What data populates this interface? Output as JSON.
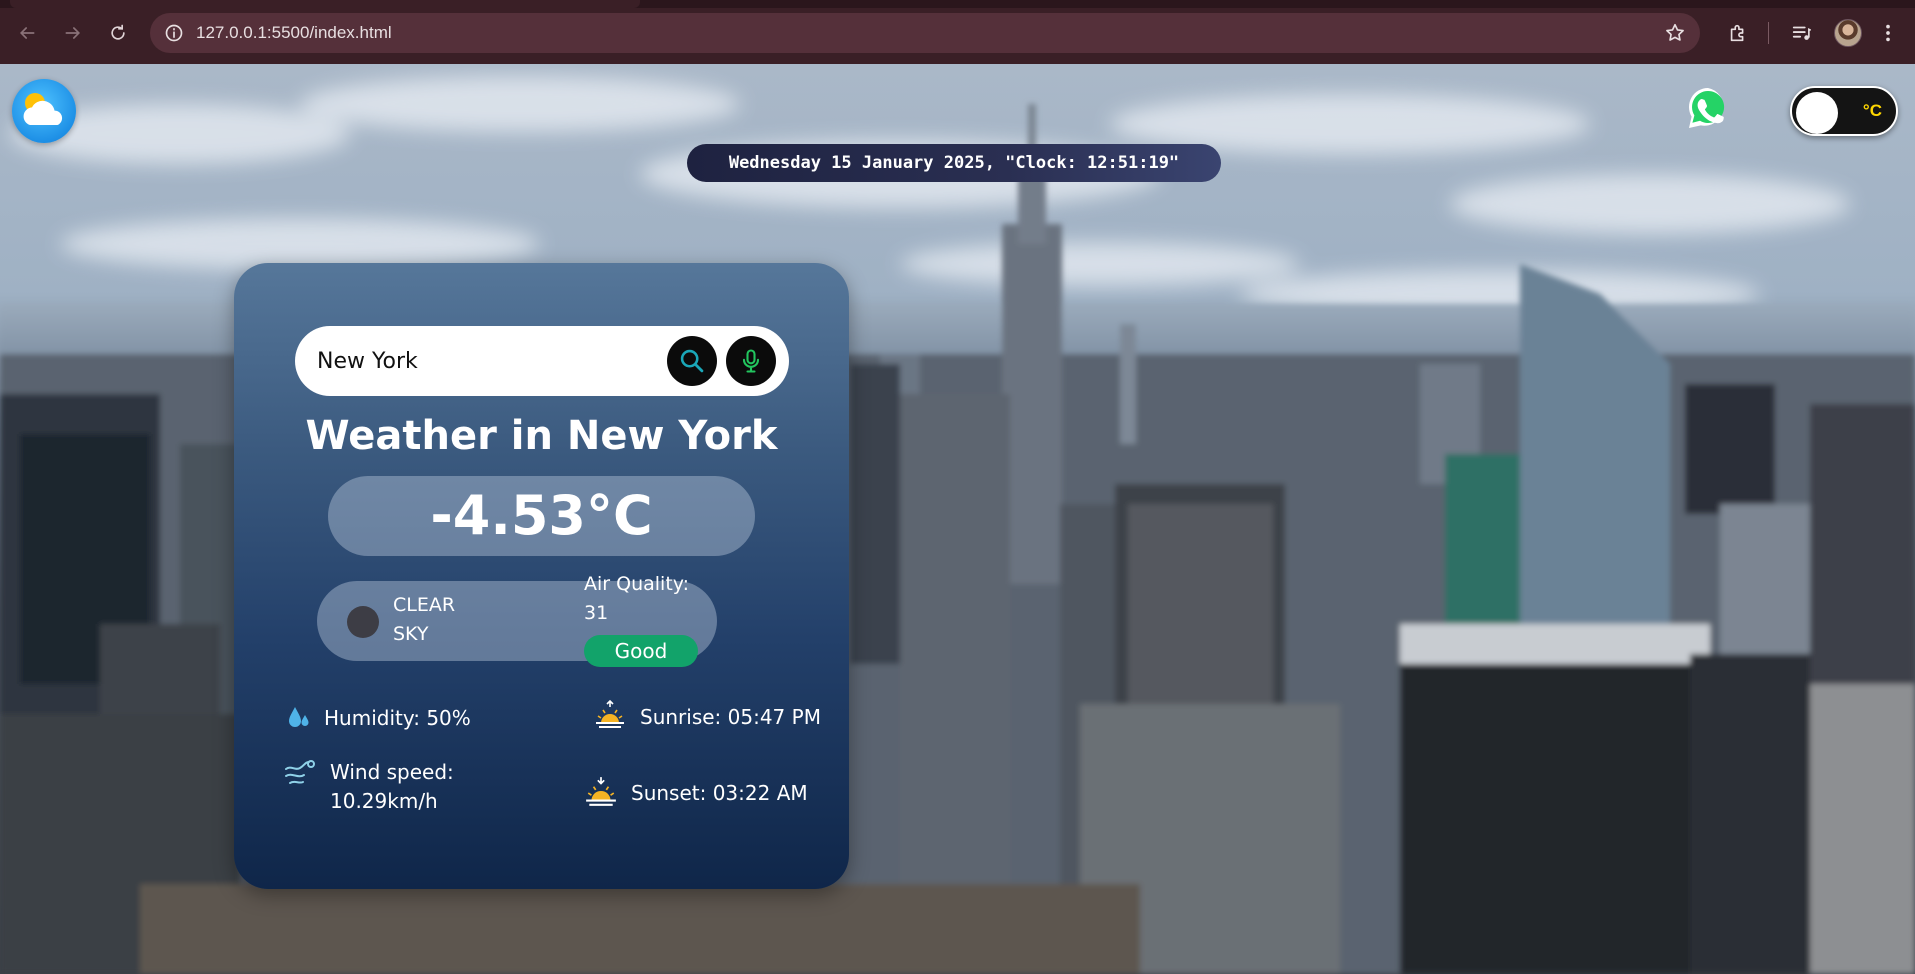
{
  "browser": {
    "url": "127.0.0.1:5500/index.html"
  },
  "page": {
    "datetime": "Wednesday 15 January 2025, \"Clock: 12:51:19\"",
    "unit_toggle_label": "°C"
  },
  "card": {
    "search_value": "New York",
    "title": "Weather in New York",
    "temperature": "-4.53°C",
    "condition_line1": "CLEAR",
    "condition_line2": "SKY",
    "air_quality_label": "Air Quality:",
    "air_quality_value": "31",
    "air_quality_status": "Good",
    "humidity": "Humidity: 50%",
    "wind_label": "Wind speed:",
    "wind_value": "10.29km/h",
    "sunrise": "Sunrise: 05:47 PM",
    "sunset": "Sunset: 03:22 AM"
  },
  "icons": {
    "logo": "cloud-sun-icon",
    "whatsapp": "whatsapp-icon",
    "search": "search-icon",
    "mic": "microphone-icon",
    "humidity": "water-drop-icon",
    "wind": "wind-icon",
    "sunrise": "sunrise-icon",
    "sunset": "sunset-icon"
  },
  "colors": {
    "browser_frame": "#3a1f26",
    "card_top": "#56779a",
    "card_bottom": "#0f2649",
    "air_quality_good": "#12a36a",
    "toggle_text": "#ffd700",
    "whatsapp_green": "#25d366"
  }
}
